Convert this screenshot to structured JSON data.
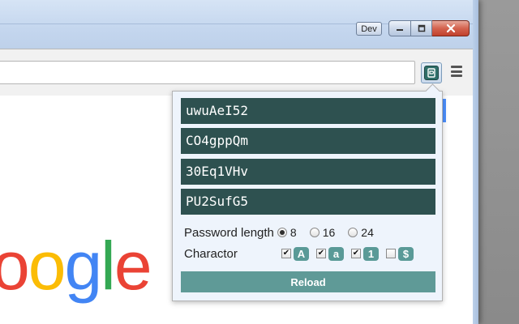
{
  "window": {
    "dev_badge": "Dev",
    "caption_buttons": {
      "minimize_icon": "minimize-icon",
      "maximize_icon": "maximize-icon",
      "close_icon": "close-icon"
    }
  },
  "toolbar": {
    "omnibox_value": "",
    "extension_icon": "password-generator-icon",
    "menu_icon": "hamburger-menu-icon"
  },
  "page": {
    "logo_letters": [
      "o",
      "o",
      "g",
      "l",
      "e"
    ]
  },
  "popup": {
    "passwords": [
      "uwuAeI52",
      "CO4gppQm",
      "30Eq1VHv",
      "PU2SufG5"
    ],
    "length_label": "Password length",
    "length_options": [
      {
        "label": "8",
        "selected": true
      },
      {
        "label": "16",
        "selected": false
      },
      {
        "label": "24",
        "selected": false
      }
    ],
    "charactor_label": "Charactor",
    "char_options": [
      {
        "label": "A",
        "checked": true
      },
      {
        "label": "a",
        "checked": true
      },
      {
        "label": "1",
        "checked": true
      },
      {
        "label": "$",
        "checked": false
      }
    ],
    "reload_label": "Reload"
  },
  "colors": {
    "password_bg": "#2e5150",
    "accent_teal": "#5f9a97",
    "popup_bg": "#eef4fc"
  }
}
